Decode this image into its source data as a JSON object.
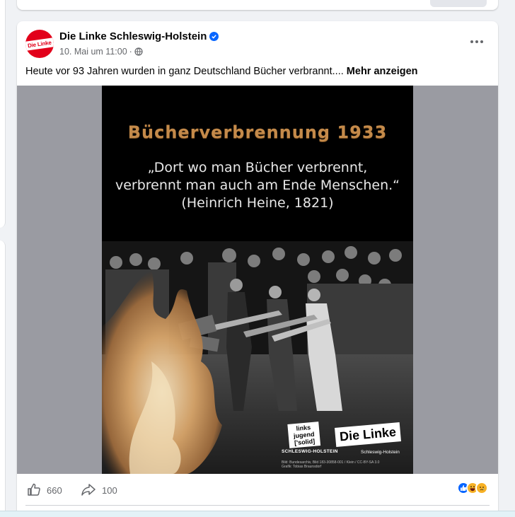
{
  "post": {
    "page_name": "Die Linke Schleswig-Holstein",
    "avatar_text": "Die Linke",
    "date": "10. Mai um 11:00",
    "separator": "·",
    "text": "Heute vor 93 Jahren wurden in ganz Deutschland Bücher verbrannt....",
    "see_more": "Mehr anzeigen",
    "more_icon": "more-options-icon",
    "verified_icon": "verified-badge-icon",
    "privacy_icon": "globe-icon"
  },
  "poster": {
    "title": "Bücherverbrennung 1933",
    "quote_line1": "„Dort wo man Bücher verbrennt,",
    "quote_line2": "verbrennt man auch am Ende Menschen.“",
    "quote_author": "(Heinrich Heine, 1821)",
    "logo1_line1": "links",
    "logo1_line2": "jugend",
    "logo1_line3": "['solid]",
    "logo1_sub": "SCHLESWIG-HOLSTEIN",
    "logo2": "Die Linke",
    "logo2_sub": "Schleswig-Holstein",
    "credit_line1": "Bild: Bundesarchiv, Bild 183-30858-001 / Klein / CC-BY-SA 3.0",
    "credit_line2": "Grafik: Tobias Braunsdorf"
  },
  "footer": {
    "likes": "660",
    "shares": "100",
    "like_icon": "thumbs-up-icon",
    "share_icon": "share-arrow-icon",
    "reaction_icons": [
      "like-reaction-icon",
      "haha-reaction-icon",
      "sad-reaction-icon"
    ]
  },
  "colors": {
    "brand_red": "#e2001a",
    "facebook_blue": "#0866ff",
    "title_bronze": "#c48a4a",
    "media_background": "#9a9ba2"
  }
}
